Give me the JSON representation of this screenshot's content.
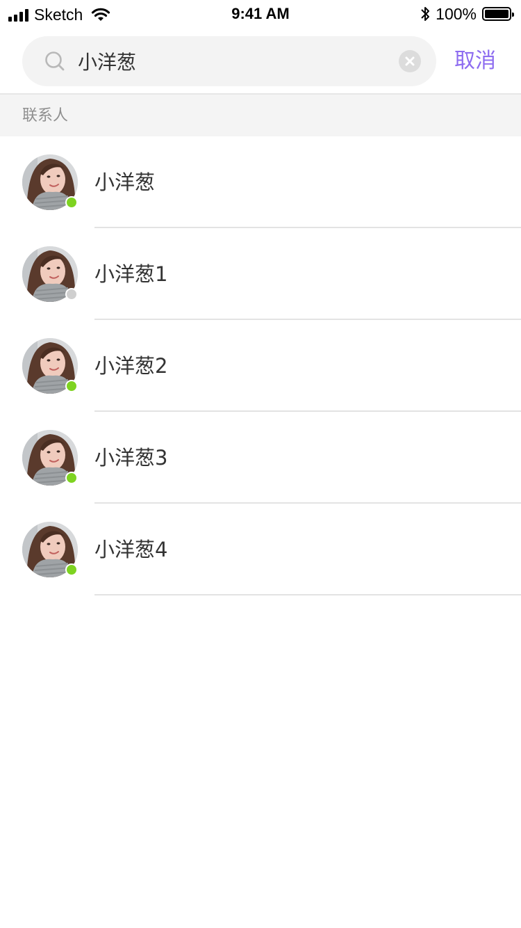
{
  "status_bar": {
    "carrier": "Sketch",
    "time": "9:41 AM",
    "battery_percent": "100%",
    "battery_level": 1.0
  },
  "search": {
    "value": "小洋葱",
    "placeholder": "",
    "icon": "search-icon",
    "clear_icon": "clear-icon",
    "cancel_label": "取消"
  },
  "section": {
    "title": "联系人"
  },
  "contacts": [
    {
      "name": "小洋葱",
      "online": true
    },
    {
      "name": "小洋葱1",
      "online": false
    },
    {
      "name": "小洋葱2",
      "online": true
    },
    {
      "name": "小洋葱3",
      "online": true
    },
    {
      "name": "小洋葱4",
      "online": true
    }
  ],
  "colors": {
    "accent": "#8d6cf0",
    "online": "#7ed321",
    "offline": "#cfcfcf",
    "section_bg": "#f4f4f4"
  }
}
